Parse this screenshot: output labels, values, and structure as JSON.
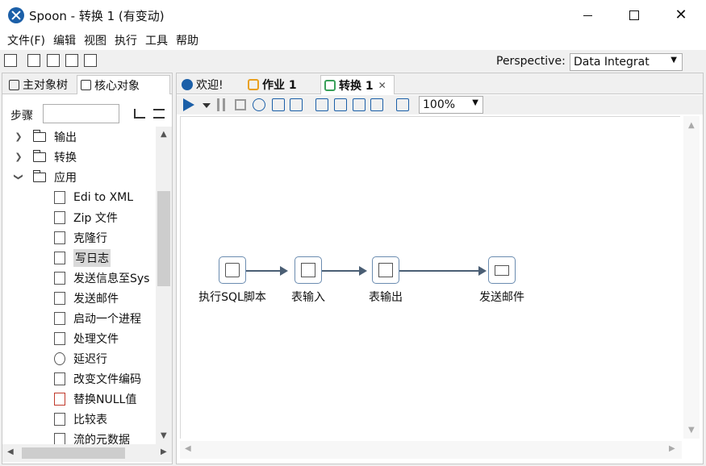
{
  "window": {
    "title": "Spoon - 转换 1 (有变动)"
  },
  "menu": [
    "文件(F)",
    "编辑",
    "视图",
    "执行",
    "工具",
    "帮助"
  ],
  "toolbar": {
    "perspective_label": "Perspective:",
    "perspective_value": "Data Integrat"
  },
  "left_tabs": [
    "主对象树",
    "核心对象"
  ],
  "steps": {
    "label": "步骤",
    "search_value": ""
  },
  "tree": [
    {
      "label": "输出",
      "type": "folder",
      "expanded": false
    },
    {
      "label": "转换",
      "type": "folder",
      "expanded": false
    },
    {
      "label": "应用",
      "type": "folder",
      "expanded": true
    },
    {
      "label": "Edi to XML",
      "type": "step"
    },
    {
      "label": "Zip 文件",
      "type": "step"
    },
    {
      "label": "克隆行",
      "type": "step"
    },
    {
      "label": "写日志",
      "type": "step",
      "selected": true
    },
    {
      "label": "发送信息至Sys",
      "type": "step"
    },
    {
      "label": "发送邮件",
      "type": "step"
    },
    {
      "label": "启动一个进程",
      "type": "step"
    },
    {
      "label": "处理文件",
      "type": "step"
    },
    {
      "label": "延迟行",
      "type": "step"
    },
    {
      "label": "改变文件编码",
      "type": "step"
    },
    {
      "label": "替换NULL值",
      "type": "step"
    },
    {
      "label": "比较表",
      "type": "step"
    },
    {
      "label": "流的元数据",
      "type": "step"
    }
  ],
  "editor_tabs": [
    {
      "label": "欢迎!",
      "icon": "welcome-icon"
    },
    {
      "label": "作业 1",
      "icon": "job-icon"
    },
    {
      "label": "转换 1",
      "icon": "transformation-icon",
      "active": true
    }
  ],
  "zoom": "100%",
  "nodes": [
    "执行SQL脚本",
    "表输入",
    "表输出",
    "发送邮件"
  ]
}
